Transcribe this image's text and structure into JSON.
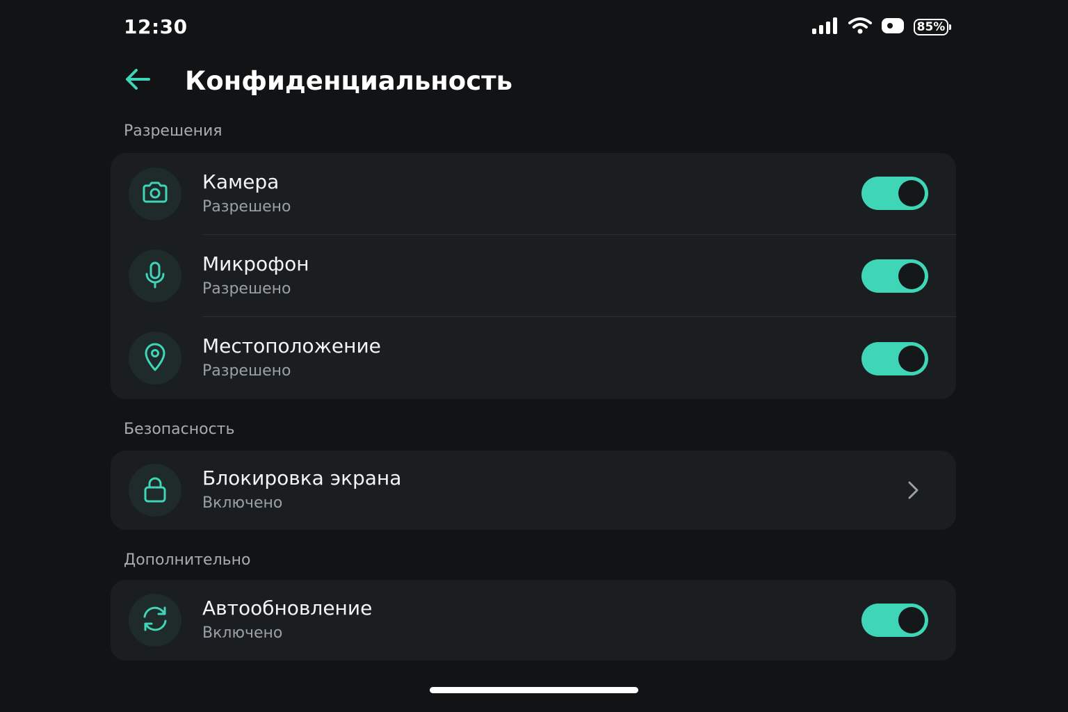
{
  "status_bar": {
    "time": "12:30",
    "battery": "85%",
    "icons": [
      "signal-icon",
      "wifi-icon",
      "screen-record-icon",
      "battery-icon"
    ]
  },
  "header": {
    "back_icon": "arrow-left-icon",
    "title": "Конфиденциальность"
  },
  "sections": {
    "permissions": {
      "label": "Разрешения",
      "items": [
        {
          "icon": "camera-icon",
          "title": "Камера",
          "subtitle": "Разрешено",
          "toggle_on": true
        },
        {
          "icon": "microphone-icon",
          "title": "Микрофон",
          "subtitle": "Разрешено",
          "toggle_on": true
        },
        {
          "icon": "location-pin-icon",
          "title": "Местоположение",
          "subtitle": "Разрешено",
          "toggle_on": true
        }
      ]
    },
    "security": {
      "label": "Безопасность",
      "items": [
        {
          "icon": "lock-icon",
          "title": "Блокировка экрана",
          "subtitle": "Включено",
          "action": "chevron-right-icon"
        }
      ]
    },
    "additional": {
      "label": "Дополнительно",
      "items": [
        {
          "icon": "refresh-icon",
          "title": "Автообновление",
          "subtitle": "Включено",
          "toggle_on": true
        }
      ]
    }
  },
  "colors": {
    "accent": "#3fd6b8",
    "background": "#111315",
    "card": "#1b1e21",
    "icon_circle": "#1f2a2b",
    "secondary_text": "#9aa1a6"
  }
}
